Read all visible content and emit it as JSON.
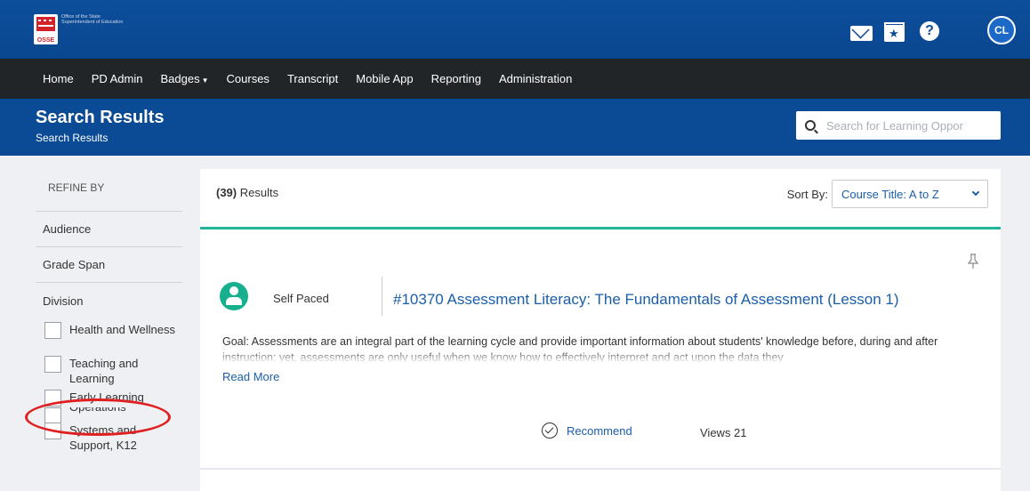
{
  "header": {
    "logo_text": "Office of the State Superintendent of Education",
    "logo_badge": "OSSE",
    "icons": [
      "mail-icon",
      "calendar-star-icon",
      "help-icon"
    ],
    "avatar_initials": "CL"
  },
  "nav": {
    "items": [
      {
        "label": "Home"
      },
      {
        "label": "PD Admin"
      },
      {
        "label": "Badges",
        "has_caret": true
      },
      {
        "label": "Courses"
      },
      {
        "label": "Transcript"
      },
      {
        "label": "Mobile App"
      },
      {
        "label": "Reporting"
      },
      {
        "label": "Administration"
      }
    ]
  },
  "page": {
    "title": "Search Results",
    "breadcrumb": "Search Results"
  },
  "search": {
    "placeholder": "Search for Learning Oppor"
  },
  "sidebar": {
    "refine_label": "REFINE BY",
    "facets": [
      "Audience",
      "Grade Span",
      "Division"
    ],
    "division_options": [
      {
        "label": "Health and Wellness",
        "checked": false
      },
      {
        "label": "Teaching and Learning",
        "checked": false
      },
      {
        "label": "Early Learning",
        "checked": false,
        "highlighted": true
      },
      {
        "label": "Operations",
        "checked": false
      },
      {
        "label": "Systems and Support, K12",
        "checked": false
      }
    ]
  },
  "results": {
    "count": "(39)",
    "count_suffix": " Results",
    "sort_label": "Sort By:",
    "sort_value": "Course Title: A to Z",
    "accent_color": "#1fb59a"
  },
  "course": {
    "pace": "Self Paced",
    "title": "#10370 Assessment Literacy: The Fundamentals of Assessment (Lesson 1)",
    "goal": "Goal: Assessments are an integral part of the learning cycle and provide important information about students' knowledge before, during and after instruction; yet, assessments are only useful when we know how to effectively interpret and act upon the data they",
    "read_more": "Read More",
    "recommend_label": "Recommend",
    "views": "Views 21"
  },
  "colors": {
    "header_blue": "#0c4b95",
    "nav_dark": "#222528",
    "link_blue": "#1a5ea8",
    "highlight_red": "#e02020"
  }
}
